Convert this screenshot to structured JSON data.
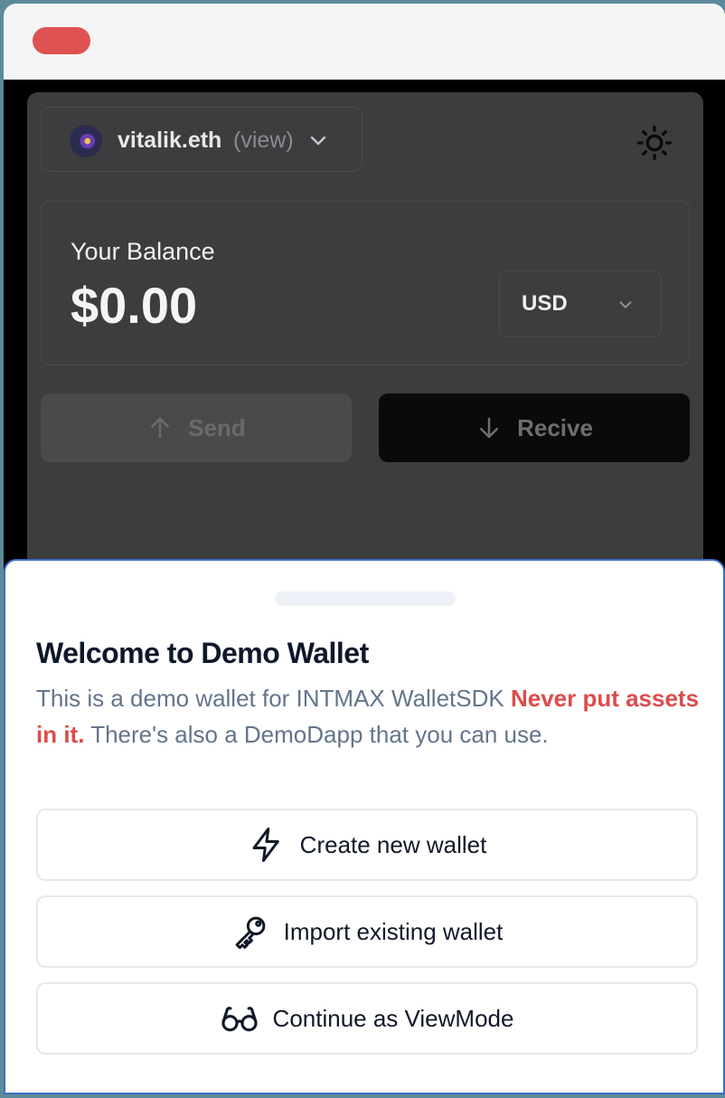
{
  "account": {
    "name": "vitalik.eth",
    "mode": "(view)"
  },
  "balance": {
    "label": "Your Balance",
    "value": "$0.00",
    "currency": "USD"
  },
  "actions": {
    "send_label": "Send",
    "receive_label": "Recive"
  },
  "sheet": {
    "title": "Welcome to Demo Wallet",
    "description_prefix": "This is a demo wallet for INTMAX WalletSDK ",
    "description_warning": "Never put assets in it.",
    "description_suffix": " There's also a DemoDapp that you can use.",
    "buttons": {
      "create": "Create new wallet",
      "import": "Import existing wallet",
      "view": "Continue as ViewMode"
    }
  },
  "icons": {
    "account_chevron": "chevron-down-icon",
    "theme": "sun-icon",
    "send": "arrow-up-icon",
    "receive": "arrow-down-icon",
    "create": "lightning-icon",
    "import": "key-icon",
    "view": "glasses-icon"
  },
  "colors": {
    "warning": "#dc4c4c",
    "sheet_border": "#3b6fc4",
    "title_text": "#0f172a",
    "muted_text": "#64748b"
  }
}
